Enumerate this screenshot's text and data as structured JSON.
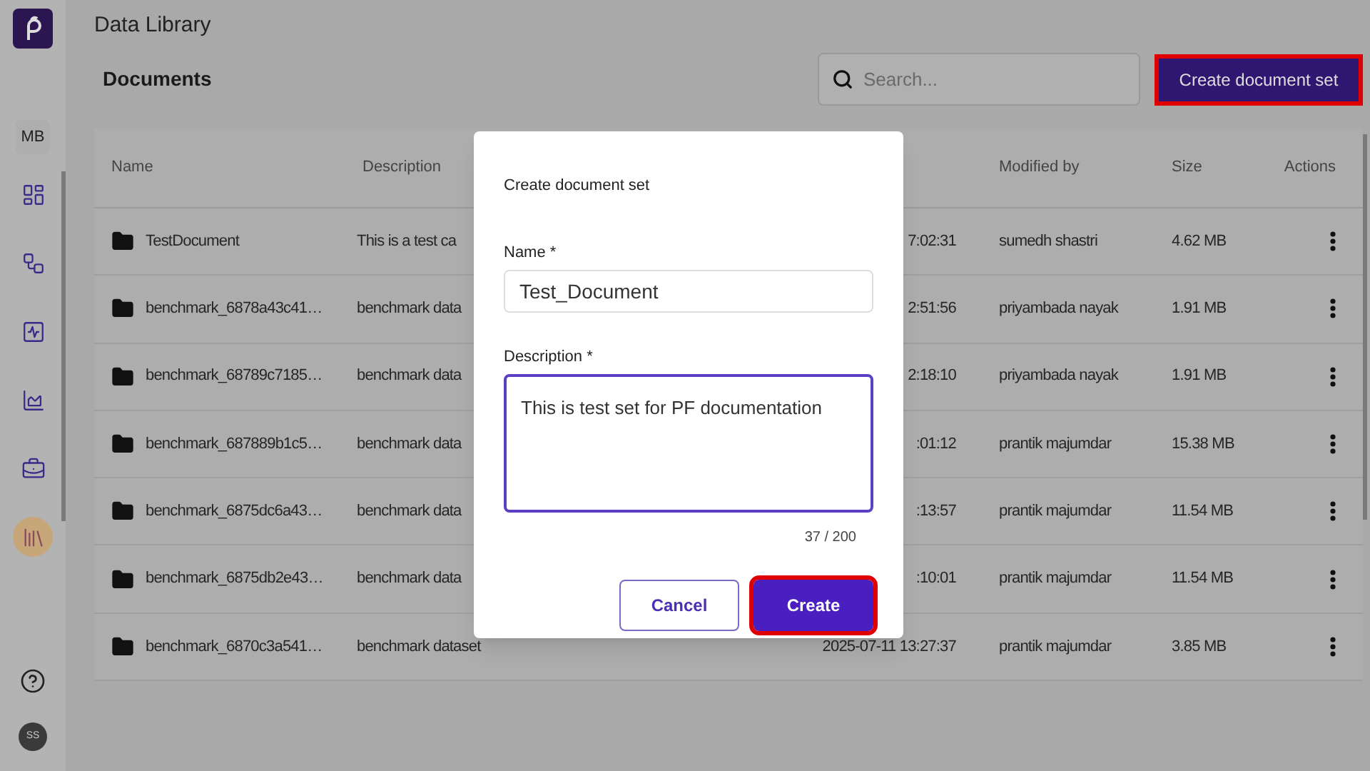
{
  "sidebar": {
    "workspace": "MB",
    "nav_items": [
      {
        "kind": "grid",
        "selected": false
      },
      {
        "kind": "network",
        "selected": false
      },
      {
        "kind": "clock",
        "selected": false
      },
      {
        "kind": "chart",
        "selected": false
      },
      {
        "kind": "case",
        "selected": false
      },
      {
        "kind": "library",
        "selected": true
      }
    ],
    "avatar": "SS"
  },
  "header": {
    "title": "Data Library",
    "subtitle": "Documents",
    "search": {
      "placeholder": "Search..."
    },
    "create_button": {
      "label": "Create document set",
      "highlighted": true
    }
  },
  "table": {
    "columns": [
      "Name",
      "Description",
      "Modified by",
      "Size",
      "Actions"
    ],
    "rows": [
      {
        "name": "TestDocument",
        "description": "This is a test ca",
        "column_3": "7:02:31",
        "modified_by": "sumedh shastri",
        "size": "4.62 MB"
      },
      {
        "name": "benchmark_6878a43c41…",
        "description": "benchmark data",
        "column_3": "2:51:56",
        "modified_by": "priyambada nayak",
        "size": "1.91 MB"
      },
      {
        "name": "benchmark_68789c7185…",
        "description": "benchmark data",
        "column_3": "2:18:10",
        "modified_by": "priyambada nayak",
        "size": "1.91 MB"
      },
      {
        "name": "benchmark_687889b1c5…",
        "description": "benchmark data",
        "column_3": ":01:12",
        "modified_by": "prantik majumdar",
        "size": "15.38 MB"
      },
      {
        "name": "benchmark_6875dc6a43…",
        "description": "benchmark data",
        "column_3": ":13:57",
        "modified_by": "prantik majumdar",
        "size": "11.54 MB"
      },
      {
        "name": "benchmark_6875db2e43…",
        "description": "benchmark data",
        "column_3": ":10:01",
        "modified_by": "prantik majumdar",
        "size": "11.54 MB"
      },
      {
        "name": "benchmark_6870c3a541…",
        "description": "benchmark dataset",
        "column_3": "2025-07-11 13:27:37",
        "modified_by": "prantik majumdar",
        "size": "3.85 MB"
      }
    ]
  },
  "dialog": {
    "title": "Create document set",
    "name_label": "Name *",
    "name_value": "Test_Document",
    "description_label": "Description *",
    "description_value": "This is test set for PF documentation",
    "description_focused": true,
    "counter": "37 / 200",
    "buttons": [
      {
        "kind": "secondary",
        "label": "Cancel",
        "highlighted": false
      },
      {
        "kind": "primary",
        "label": "Create",
        "highlighted": true
      }
    ]
  }
}
